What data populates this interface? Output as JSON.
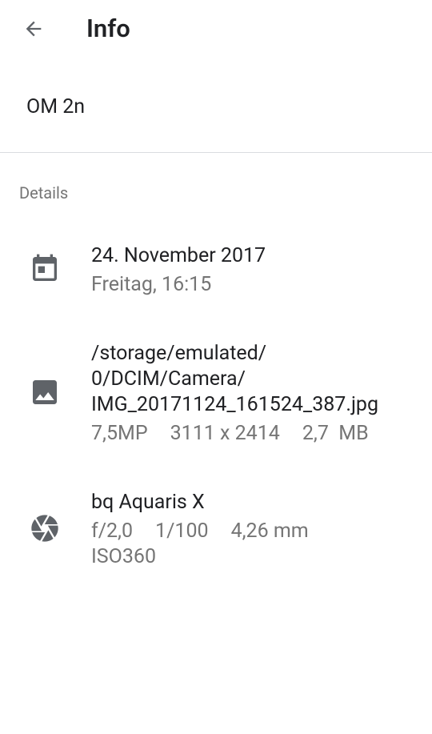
{
  "header": {
    "back_icon": "arrow-back-icon",
    "title": "Info"
  },
  "item_name": "OM 2n",
  "section": {
    "label": "Details"
  },
  "date": {
    "icon": "calendar-icon",
    "primary": "24. November 2017",
    "secondary": "Freitag, 16:15"
  },
  "file": {
    "icon": "image-icon",
    "path_lines": [
      "/storage/emulated/",
      "0/DCIM/Camera/",
      "IMG_20171124_161524_387.jpg"
    ],
    "resolution": "7,5MP",
    "dimensions": "3111 x 2414",
    "size": "2,7  MB"
  },
  "camera": {
    "icon": "camera-shutter-icon",
    "model": "bq Aquaris X",
    "aperture": "f/2,0",
    "exposure": "1/100",
    "focal_length": "4,26 mm",
    "iso": "ISO360"
  },
  "colors": {
    "primary_text": "#202124",
    "secondary_text": "#757575",
    "icon": "#5f6368",
    "divider": "#dadce0",
    "background": "#ffffff"
  }
}
